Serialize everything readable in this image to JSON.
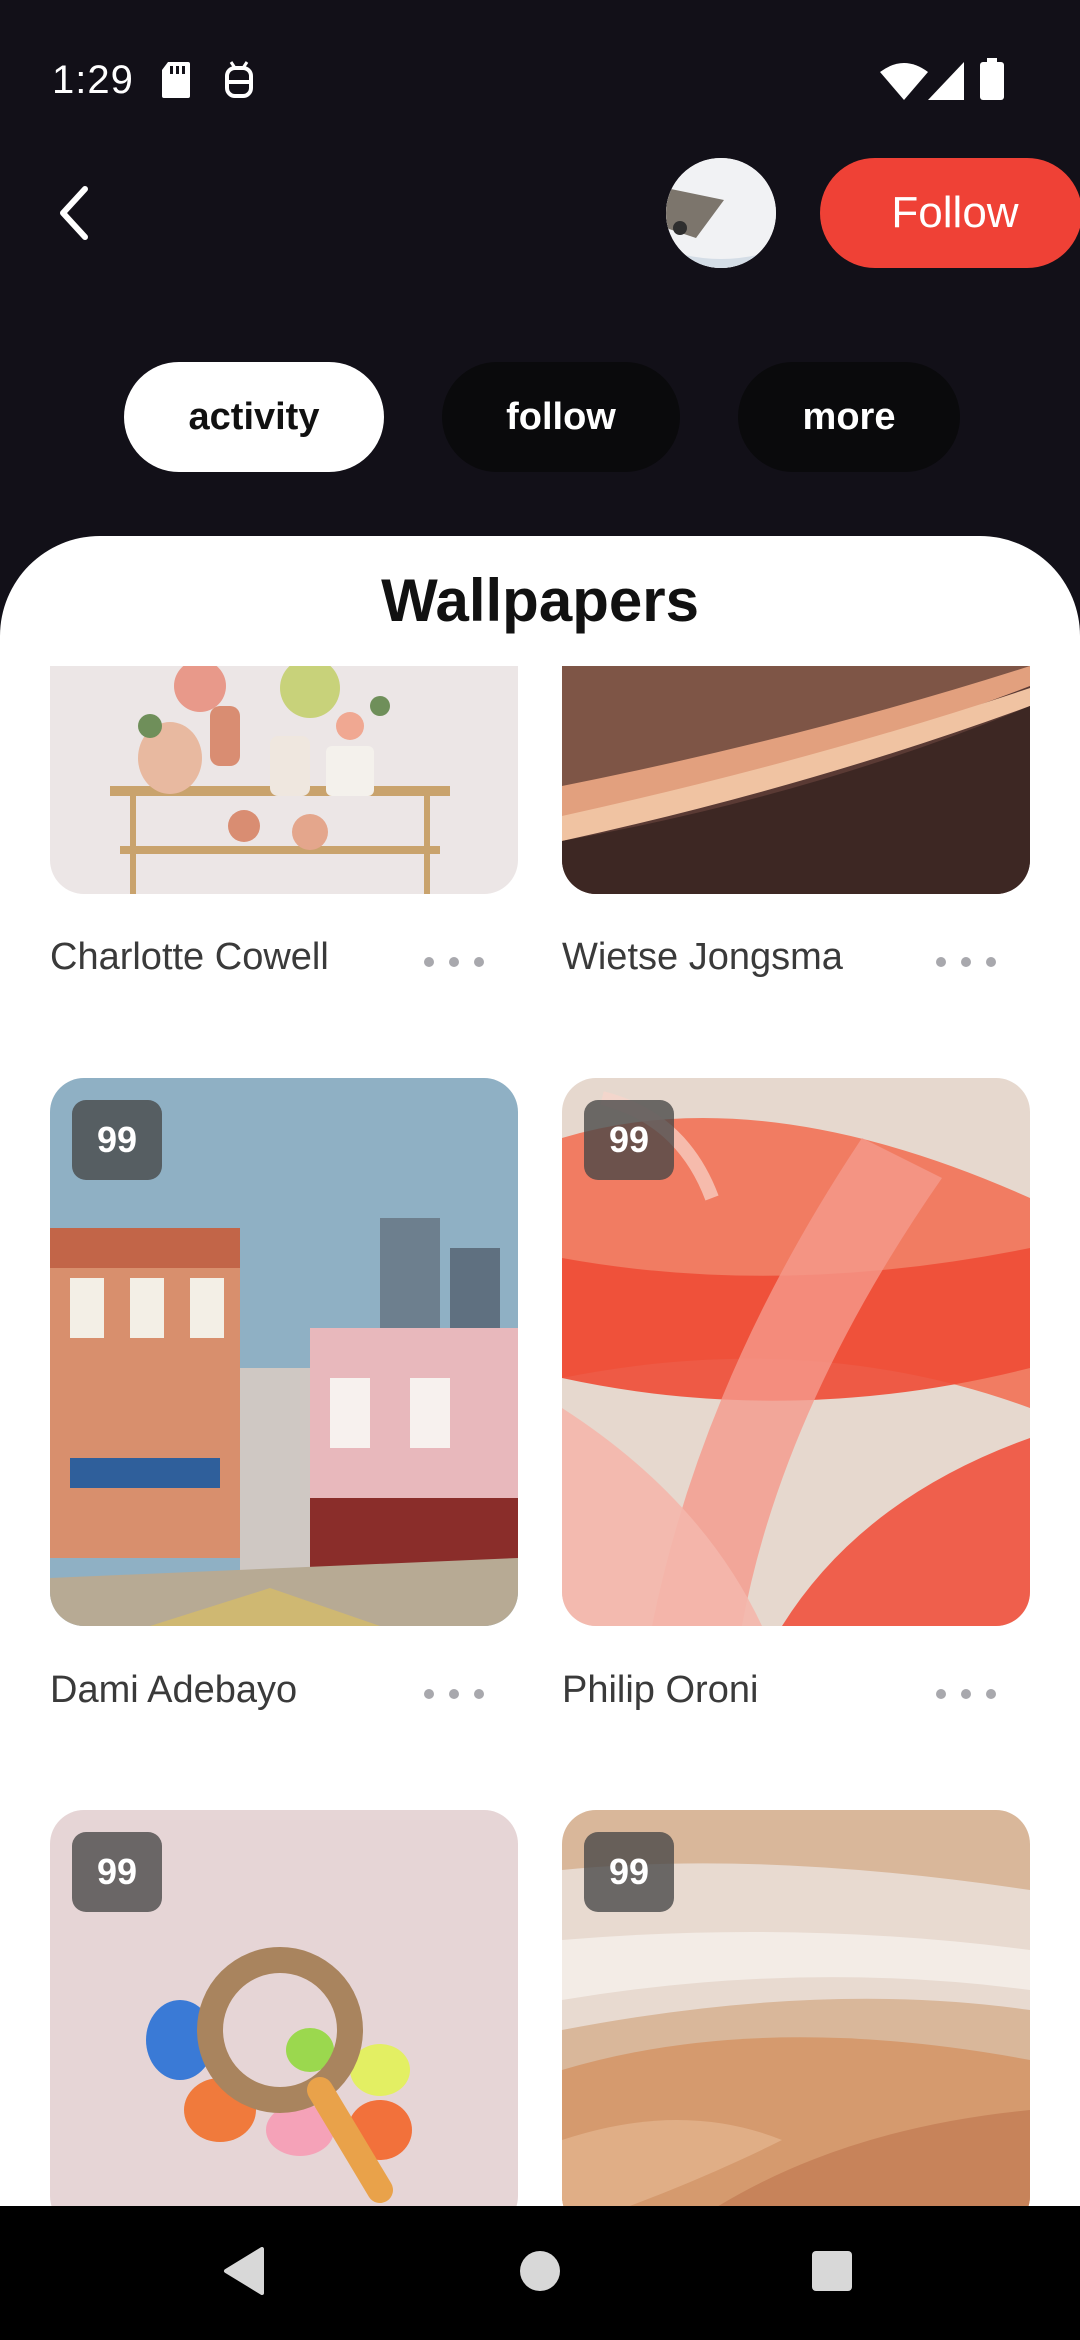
{
  "status_bar": {
    "time": "1:29",
    "left_icons": [
      "sd-card-icon",
      "android-debug-icon"
    ],
    "right_icons": [
      "wifi-icon",
      "signal-icon",
      "battery-icon"
    ]
  },
  "header": {
    "back_icon": "chevron-left-icon",
    "follow_label": "Follow",
    "colors": {
      "follow_bg": "#ef4136",
      "page_bg": "#121018"
    }
  },
  "tabs": [
    {
      "label": "activity",
      "selected": true
    },
    {
      "label": "follow",
      "selected": false
    },
    {
      "label": "more",
      "selected": false
    }
  ],
  "section_title": "Wallpapers",
  "wallpapers": [
    {
      "author": "Charlotte Cowell",
      "badge": ""
    },
    {
      "author": "Wietse Jongsma",
      "badge": ""
    },
    {
      "author": "Dami Adebayo",
      "badge": "99"
    },
    {
      "author": "Philip Oroni",
      "badge": "99"
    },
    {
      "author": "",
      "badge": "99"
    },
    {
      "author": "",
      "badge": "99"
    }
  ],
  "nav_bar": {
    "icons": [
      "back-triangle-icon",
      "home-circle-icon",
      "recents-square-icon"
    ]
  }
}
